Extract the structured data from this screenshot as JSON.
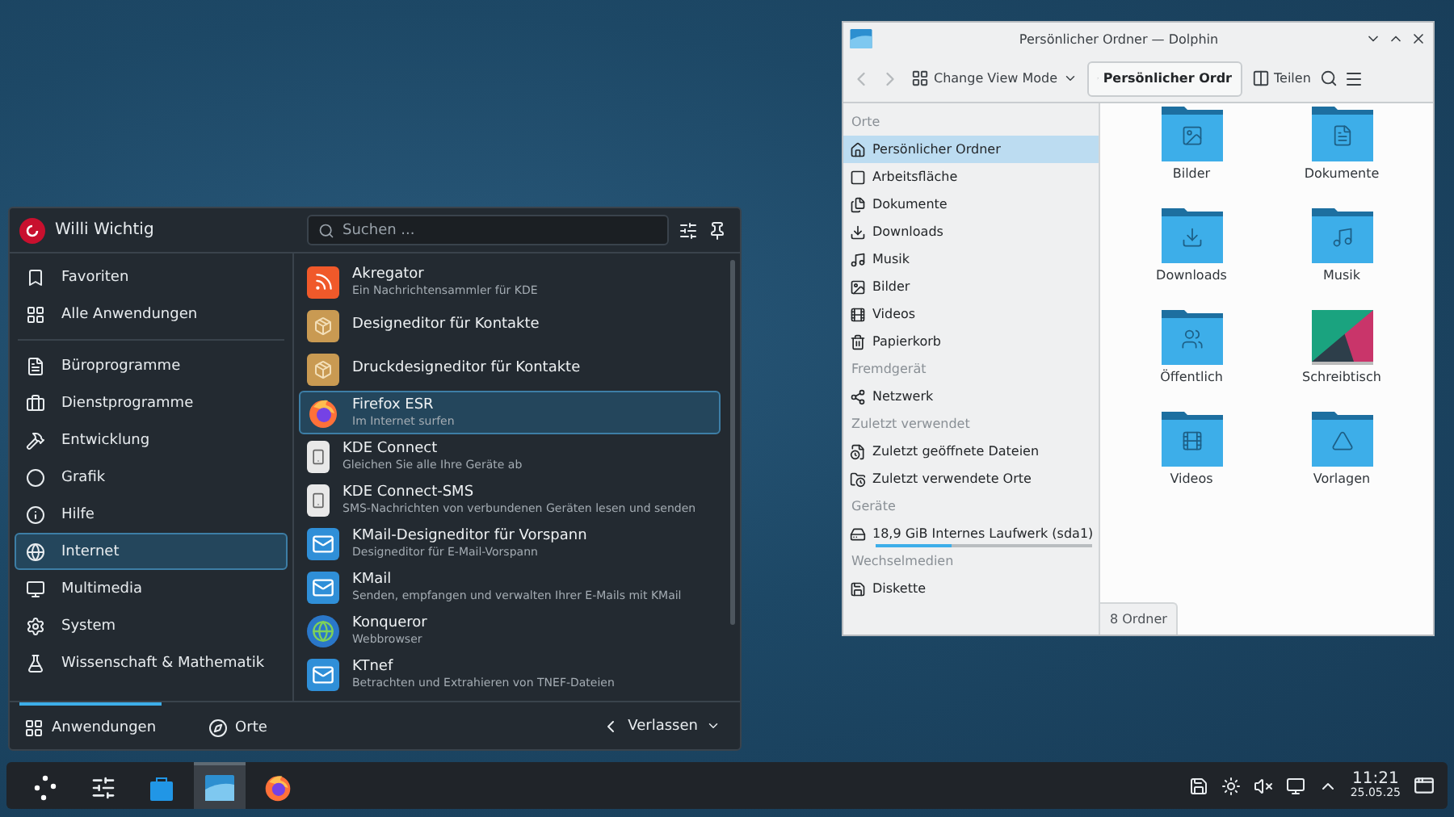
{
  "launcher": {
    "user": "Willi Wichtig",
    "search": {
      "placeholder": "Suchen ..."
    },
    "category_groups": [
      {
        "items": [
          {
            "label": "Favoriten",
            "kind": "bookmark",
            "selected": false
          },
          {
            "label": "Alle Anwendungen",
            "kind": "grid",
            "selected": false
          }
        ]
      },
      {
        "items": [
          {
            "label": "Büroprogramme",
            "kind": "office",
            "selected": false
          },
          {
            "label": "Dienstprogramme",
            "kind": "toolbox",
            "selected": false
          },
          {
            "label": "Entwicklung",
            "kind": "hammer",
            "selected": false
          },
          {
            "label": "Grafik",
            "kind": "shape",
            "selected": false
          },
          {
            "label": "Hilfe",
            "kind": "info",
            "selected": false
          },
          {
            "label": "Internet",
            "kind": "globe",
            "selected": true
          },
          {
            "label": "Multimedia",
            "kind": "monitor",
            "selected": false
          },
          {
            "label": "System",
            "kind": "gear",
            "selected": false
          },
          {
            "label": "Wissenschaft & Mathematik",
            "kind": "flask",
            "selected": false
          }
        ]
      }
    ],
    "apps": [
      {
        "name": "Akregator",
        "description": "Ein Nachrichtensammler für KDE",
        "kind": "feed",
        "selected": false
      },
      {
        "name": "Designeditor für Kontakte",
        "kind": "box",
        "selected": false
      },
      {
        "name": "Druckdesigneditor für Kontakte",
        "kind": "box",
        "selected": false
      },
      {
        "name": "Firefox ESR",
        "description": "Im Internet surfen",
        "kind": "firefox",
        "selected": true
      },
      {
        "name": "KDE Connect",
        "description": "Gleichen Sie alle Ihre Geräte ab",
        "kind": "phone",
        "selected": false
      },
      {
        "name": "KDE Connect-SMS",
        "description": "SMS-Nachrichten von verbundenen Geräten lesen und senden",
        "kind": "phone",
        "selected": false
      },
      {
        "name": "KMail-Designeditor für Vorspann",
        "description": "Designeditor für E-Mail-Vorspann",
        "kind": "mail",
        "selected": false
      },
      {
        "name": "KMail",
        "description": "Senden, empfangen und verwalten Ihrer E-Mails mit KMail",
        "kind": "mail",
        "selected": false
      },
      {
        "name": "Konqueror",
        "description": "Webbrowser",
        "kind": "globe",
        "selected": false
      },
      {
        "name": "KTnef",
        "description": "Betrachten und Extrahieren von TNEF-Dateien",
        "kind": "mail",
        "selected": false
      }
    ],
    "footer_tabs": [
      {
        "label": "Anwendungen",
        "kind": "grid",
        "selected": true
      },
      {
        "label": "Orte",
        "kind": "compass",
        "selected": false
      }
    ],
    "leave_button": "Verlassen"
  },
  "dolphin": {
    "title": "Persönlicher Ordner — Dolphin",
    "view_mode": "Change View Mode",
    "breadcrumb": "Persönlicher Ordr",
    "share": "Teilen",
    "places": [
      {
        "heading": "Orte",
        "items": [
          {
            "label": "Persönlicher Ordner",
            "kind": "home",
            "selected": true
          },
          {
            "label": "Arbeitsfläche",
            "kind": "desktop",
            "selected": false
          },
          {
            "label": "Dokumente",
            "kind": "docs",
            "selected": false
          },
          {
            "label": "Downloads",
            "kind": "download",
            "selected": false
          },
          {
            "label": "Musik",
            "kind": "music",
            "selected": false
          },
          {
            "label": "Bilder",
            "kind": "image",
            "selected": false
          },
          {
            "label": "Videos",
            "kind": "video",
            "selected": false
          },
          {
            "label": "Papierkorb",
            "kind": "trash",
            "selected": false
          }
        ]
      },
      {
        "heading": "Fremdgerät",
        "items": [
          {
            "label": "Netzwerk",
            "kind": "network",
            "selected": false
          }
        ]
      },
      {
        "heading": "Zuletzt verwendet",
        "items": [
          {
            "label": "Zuletzt geöffnete Dateien",
            "kind": "recentfile",
            "selected": false
          },
          {
            "label": "Zuletzt verwendete Orte",
            "kind": "recentfolder",
            "selected": false
          }
        ]
      },
      {
        "heading": "Geräte",
        "items": [
          {
            "label": "18,9 GiB Internes Laufwerk (sda1)",
            "kind": "drive",
            "selected": false,
            "level": 0.35
          }
        ]
      },
      {
        "heading": "Wechselmedien",
        "items": [
          {
            "label": "Diskette",
            "kind": "floppy",
            "selected": false
          }
        ]
      }
    ],
    "folders": [
      {
        "label": "Bilder",
        "kind": "image"
      },
      {
        "label": "Dokumente",
        "kind": "docs"
      },
      {
        "label": "Downloads",
        "kind": "download"
      },
      {
        "label": "Musik",
        "kind": "music"
      },
      {
        "label": "Öffentlich",
        "kind": "people"
      },
      {
        "label": "Schreibtisch",
        "kind": "wallpaper"
      },
      {
        "label": "Videos",
        "kind": "video"
      },
      {
        "label": "Vorlagen",
        "kind": "template"
      }
    ],
    "status": "8 Ordner"
  },
  "taskbar": {
    "tasks": [
      {
        "kind": "launcher",
        "selected": false
      },
      {
        "kind": "settings",
        "selected": false
      },
      {
        "kind": "store",
        "selected": false
      },
      {
        "kind": "files",
        "selected": true
      },
      {
        "kind": "firefox",
        "selected": false
      }
    ],
    "time": "11:21",
    "date": "25.05.25"
  }
}
